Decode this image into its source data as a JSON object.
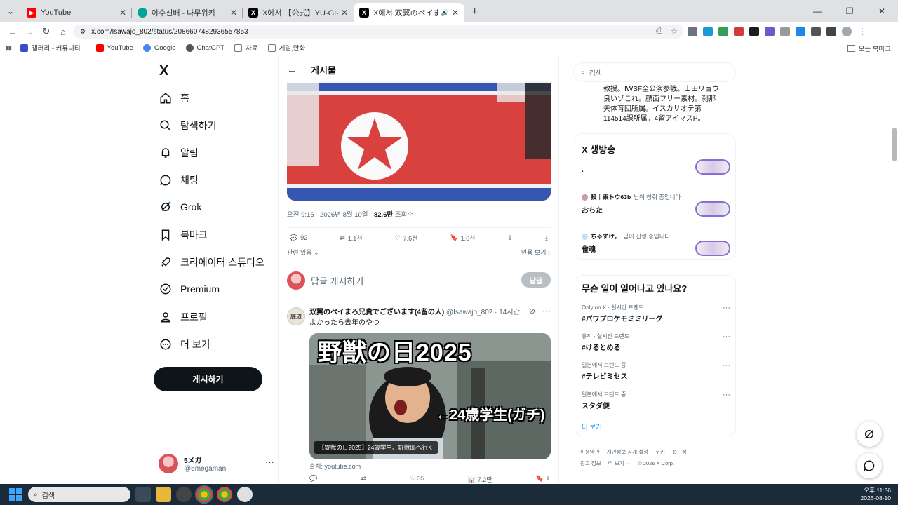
{
  "browser": {
    "tabs": [
      {
        "title": "YouTube",
        "favicon_color": "#ff0000",
        "active": false
      },
      {
        "title": "야수선배 - 나무위키",
        "favicon_color": "#00a495",
        "active": false
      },
      {
        "title": "X에서 【公式】YU-GI-OH.jp 님 :",
        "favicon_color": "#000000",
        "active": false
      },
      {
        "title": "X에서 双翼のペイまろ兄貴",
        "favicon_color": "#000000",
        "active": true
      }
    ],
    "url": "x.com/Isawajo_802/status/2086607482936557853",
    "bookmarks": [
      {
        "label": "갤러리 - 커뮤니티...",
        "color": "#3b4cca"
      },
      {
        "label": "YouTube",
        "color": "#ff0000"
      },
      {
        "label": "Google",
        "color": "#4285f4"
      },
      {
        "label": "ChatGPT",
        "color": "#555555"
      },
      {
        "label": "자료",
        "color": "#777777"
      },
      {
        "label": "게임,만화",
        "color": "#777777"
      }
    ],
    "all_bookmarks": "모든 북마크"
  },
  "nav": {
    "logo": "X",
    "items": [
      "홈",
      "탐색하기",
      "알림",
      "채팅",
      "Grok",
      "북마크",
      "크리에이터 스튜디오",
      "Premium",
      "프로필",
      "더 보기"
    ],
    "post_button": "게시하기",
    "profile_name": "5メガ",
    "profile_handle": "@5megaman"
  },
  "main": {
    "header_title": "게시물",
    "meta_time": "오전 9:16 · 2026년 8월 10일 · ",
    "meta_views": "82.6만",
    "meta_views_label": " 조회수",
    "actions": {
      "reply": "92",
      "repost": "1.1천",
      "like": "7.6천",
      "bookmark": "1.6천"
    },
    "related": "관련 있음",
    "quotes": "인용 보기",
    "reply_placeholder": "답글 게시하기",
    "reply_button": "답글",
    "tweet": {
      "avatar_text": "底辺",
      "name": "双翼のペイまろ兄貴でございます(4留の人)",
      "handle": "@Isawajo_802 · 14시간",
      "text": "よかったら去年のやつ",
      "thumb_title": "野獣の日2025",
      "thumb_sub": "←24歳学生(ガチ)",
      "thumb_caption": "【野獣の日2025】24歳学生、野獣邸へ行く",
      "source": "출처: youtube.com",
      "like": "35",
      "views": "7.2만"
    }
  },
  "right": {
    "search_placeholder": "검색",
    "bio": "教授。IWSF全公演参戦。山田リョウ良いゾこれ。顔面フリー素材。刹那矢体育団所属。イスカリオテ第114514課所属。4留アイマスP。",
    "live_title": "X 생방송",
    "live": [
      {
        "host": "",
        "status": "",
        "title": "."
      },
      {
        "host": "殺｜東トウ63b",
        "status": "님이 청취 중입니다",
        "title": "おちた"
      },
      {
        "host": "ちゃずけ。",
        "status": "님이 진행 중입니다",
        "title": "雀魂"
      }
    ],
    "trends_title": "무슨 일이 일어나고 있나요?",
    "trends": [
      {
        "category": "Only on X · 실시간 트렌드",
        "name": "#パワプロケモミミリーグ"
      },
      {
        "category": "유직 · 실시간 트렌드",
        "name": "#けるとめる"
      },
      {
        "category": "일본에서 트렌드 중",
        "name": "#テレビミセス"
      },
      {
        "category": "일본에서 트렌드 중",
        "name": "スタダ便"
      }
    ],
    "show_more": "더 보기",
    "footer": [
      "이용약관",
      "개인정보 공개 설정",
      "쿠키",
      "접근성",
      "광고 정보",
      "더 보기 ···",
      "© 2026 X Corp."
    ]
  },
  "taskbar": {
    "search": "검색",
    "time": "오후 11:36",
    "date": "2026-08-10"
  }
}
